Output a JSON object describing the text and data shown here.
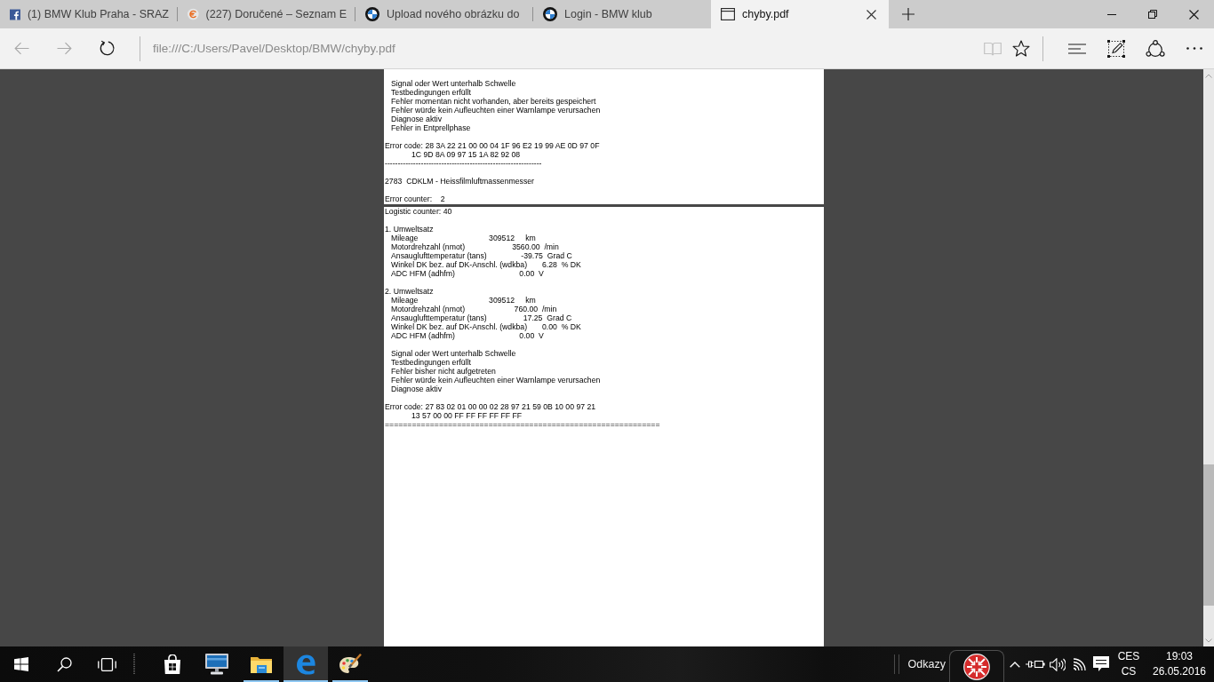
{
  "browser": {
    "tabs": [
      {
        "kind": "f-square",
        "title": "(1) BMW Klub Praha - SRAZ",
        "selected": false
      },
      {
        "kind": "euro-disc",
        "title": "(227) Doručené – Seznam E",
        "selected": false
      },
      {
        "kind": "roundel",
        "title": "Upload nového obrázku do",
        "selected": false
      },
      {
        "kind": "roundel",
        "title": "Login - BMW klub",
        "selected": false
      },
      {
        "kind": "page",
        "title": "chyby.pdf",
        "selected": true
      }
    ],
    "navigation": [
      {
        "kind": "back",
        "disabled": true
      },
      {
        "kind": "forward",
        "disabled": true
      },
      {
        "kind": "refresh",
        "disabled": false
      }
    ],
    "address": {
      "url": "file:///C:/Users/Pavel/Desktop/BMW/chyby.pdf"
    },
    "tools": [
      {
        "kind": "reading_view",
        "disabled": true
      },
      {
        "kind": "favorite",
        "disabled": false
      },
      {
        "kind": "hub",
        "disabled": false
      },
      {
        "kind": "web_note",
        "disabled": false
      },
      {
        "kind": "share",
        "disabled": false
      },
      {
        "kind": "more",
        "disabled": false
      }
    ]
  },
  "document": {
    "pages": [
      {
        "blocks": [
          {
            "lines": [
              {
                "kind": "indented",
                "text": "Signal oder Wert unterhalb Schwelle"
              },
              {
                "kind": "indented",
                "text": "Testbedingungen erfüllt"
              },
              {
                "kind": "indented",
                "text": "Fehler momentan nicht vorhanden, aber bereits gespeichert"
              },
              {
                "kind": "indented",
                "text": "Fehler würde kein Aufleuchten einer Warnlampe verursachen"
              },
              {
                "kind": "indented",
                "text": "Diagnose aktiv"
              },
              {
                "kind": "indented",
                "text": "Fehler in Entprellphase"
              }
            ]
          },
          {
            "lines": [
              {
                "kind": "plain",
                "text": "Error code: 28 3A 22 21 00 00 04 1F 96 E2 19 99 AE 0D 97 0F"
              },
              {
                "kind": "continuation",
                "text": "1C 9D 8A 09 97 15 1A 82 92 08"
              },
              {
                "kind": "rule",
                "text": "-------------------------------------------------------------"
              }
            ]
          },
          {
            "lines": [
              {
                "kind": "plain",
                "text": "2783  CDKLM - Heissfilmluftmassenmesser"
              }
            ]
          },
          {
            "lines": [
              {
                "kind": "plain",
                "text": "Error counter:    2"
              }
            ]
          }
        ]
      },
      {
        "blocks": [
          {
            "lines": [
              {
                "kind": "plain",
                "text": "Logistic counter: 40"
              }
            ]
          },
          {
            "lines": [
              {
                "kind": "plain",
                "text": "1. Umweltsatz"
              },
              {
                "kind": "indented",
                "text": "Mileage                                 309512     km"
              },
              {
                "kind": "indented",
                "text": "Motordrehzahl (nmot)                      3560.00  /min"
              },
              {
                "kind": "indented",
                "text": "Ansauglufttemperatur (tans)                -39.75  Grad C"
              },
              {
                "kind": "indented",
                "text": "Winkel DK bez. auf DK-Anschl. (wdkba)       6.28  % DK"
              },
              {
                "kind": "indented",
                "text": "ADC HFM (adhfm)                              0.00  V"
              }
            ]
          },
          {
            "lines": [
              {
                "kind": "plain",
                "text": "2. Umweltsatz"
              },
              {
                "kind": "indented",
                "text": "Mileage                                 309512     km"
              },
              {
                "kind": "indented",
                "text": "Motordrehzahl (nmot)                       760.00  /min"
              },
              {
                "kind": "indented",
                "text": "Ansauglufttemperatur (tans)                 17.25  Grad C"
              },
              {
                "kind": "indented",
                "text": "Winkel DK bez. auf DK-Anschl. (wdkba)       0.00  % DK"
              },
              {
                "kind": "indented",
                "text": "ADC HFM (adhfm)                              0.00  V"
              }
            ]
          },
          {
            "lines": [
              {
                "kind": "indented",
                "text": "Signal oder Wert unterhalb Schwelle"
              },
              {
                "kind": "indented",
                "text": "Testbedingungen erfüllt"
              },
              {
                "kind": "indented",
                "text": "Fehler bisher nicht aufgetreten"
              },
              {
                "kind": "indented",
                "text": "Fehler würde kein Aufleuchten einer Warnlampe verursachen"
              },
              {
                "kind": "indented",
                "text": "Diagnose aktiv"
              }
            ]
          },
          {
            "lines": [
              {
                "kind": "plain",
                "text": "Error code: 27 83 02 01 00 00 02 28 97 21 59 0B 10 00 97 21"
              },
              {
                "kind": "continuation",
                "text": "13 57 00 00 FF FF FF FF FF FF"
              },
              {
                "kind": "rule",
                "text": "============================================================="
              }
            ]
          }
        ]
      }
    ]
  },
  "taskbar": {
    "apps": [
      {
        "kind": "store",
        "running": false,
        "selected": false
      },
      {
        "kind": "monitor",
        "running": false,
        "selected": false
      },
      {
        "kind": "folder",
        "running": true,
        "selected": false
      },
      {
        "kind": "browser",
        "running": true,
        "selected": true
      },
      {
        "kind": "paint",
        "running": true,
        "selected": false
      }
    ],
    "toolbar_label": "Odkazy",
    "language": "CES",
    "keyboard_layout": "CS",
    "time": "19:03",
    "date": "26.05.2016"
  }
}
